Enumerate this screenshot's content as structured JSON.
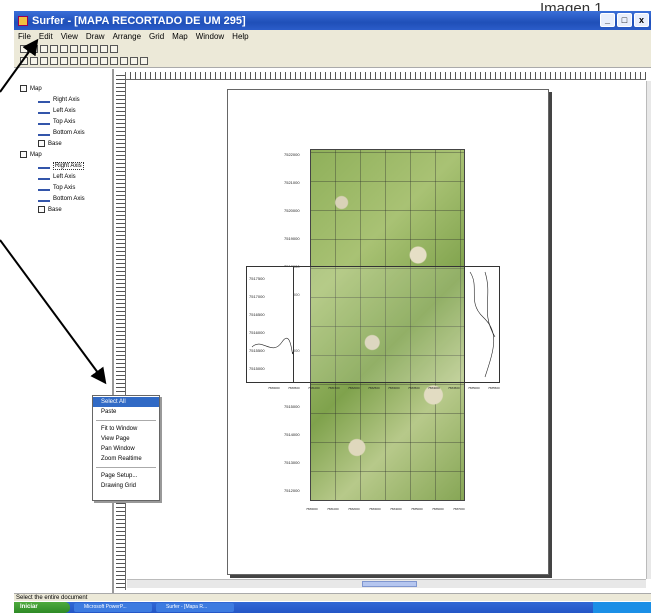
{
  "corner_label": "Imagen 1",
  "window": {
    "title": "Surfer - [MAPA RECORTADO DE UM 295]",
    "buttons": [
      "_",
      "□",
      "x"
    ]
  },
  "menu": [
    "File",
    "Edit",
    "View",
    "Draw",
    "Arrange",
    "Grid",
    "Map",
    "Window",
    "Help"
  ],
  "object_tree": {
    "groups": [
      {
        "label": "Map",
        "children": [
          "Right Axis",
          "Left Axis",
          "Top Axis",
          "Bottom Axis"
        ],
        "base": "Base"
      },
      {
        "label": "Map",
        "children": [
          "Right Axis",
          "Left Axis",
          "Top Axis",
          "Bottom Axis"
        ],
        "base": "Base"
      }
    ]
  },
  "plot": {
    "left_ticks": [
      "7522000",
      "7521000",
      "7520000",
      "7519000",
      "7518000",
      "7517000",
      "7516000",
      "7515000",
      "7514000",
      "7513000",
      "7512000"
    ],
    "inner_left_ticks": [
      "7517500",
      "7517000",
      "7516500",
      "7516000",
      "7515500",
      "7515000"
    ],
    "bottom_ticks": [
      "7580000",
      "7581000",
      "7582000",
      "7583000",
      "7584000",
      "7585000",
      "7586000",
      "7587000"
    ],
    "middle_ticks": [
      "7580000",
      "7580500",
      "7581000",
      "7581500",
      "7582000",
      "7582500",
      "7583000",
      "7583500",
      "7584000",
      "7584500",
      "7585000",
      "7585500"
    ]
  },
  "context_menu": {
    "items": [
      "Select All",
      "Paste",
      "Fit to Window",
      "View Page",
      "Pan Window",
      "Zoom Realtime",
      "Page Setup...",
      "Drawing Grid"
    ],
    "active_index": 0
  },
  "status": "Select the entire document",
  "taskbar": {
    "start": "Iniciar",
    "tasks": [
      "Microsoft PowerP...",
      "Surfer - [Mapa R..."
    ]
  }
}
